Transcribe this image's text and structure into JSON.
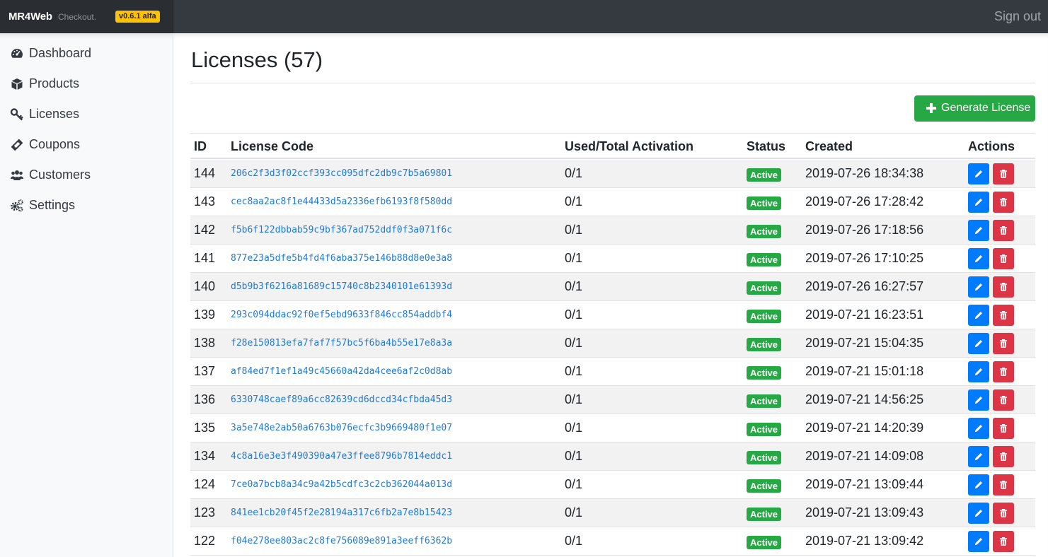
{
  "header": {
    "brand": "MR4Web",
    "brand_sub": "Checkout.",
    "version": "v0.6.1 alfa",
    "signout_label": "Sign out"
  },
  "sidebar": {
    "items": [
      {
        "label": "Dashboard",
        "icon": "tachometer-icon"
      },
      {
        "label": "Products",
        "icon": "box-icon"
      },
      {
        "label": "Licenses",
        "icon": "key-icon"
      },
      {
        "label": "Coupons",
        "icon": "ticket-icon"
      },
      {
        "label": "Customers",
        "icon": "users-icon"
      },
      {
        "label": "Settings",
        "icon": "cogs-icon"
      }
    ]
  },
  "main": {
    "title": "Licenses (57)",
    "generate_button": "Generate License",
    "columns": [
      "ID",
      "License Code",
      "Used/Total Activation",
      "Status",
      "Created",
      "Actions"
    ],
    "rows": [
      {
        "id": "144",
        "code": "206c2f3d3f02ccf393cc095dfc2db9c7b5a69801",
        "activation": "0/1",
        "status": "Active",
        "created": "2019-07-26 18:34:38"
      },
      {
        "id": "143",
        "code": "cec8aa2ac8f1e44433d5a2336efb6193f8f580dd",
        "activation": "0/1",
        "status": "Active",
        "created": "2019-07-26 17:28:42"
      },
      {
        "id": "142",
        "code": "f5b6f122dbbab59c9bf367ad752ddf0f3a071f6c",
        "activation": "0/1",
        "status": "Active",
        "created": "2019-07-26 17:18:56"
      },
      {
        "id": "141",
        "code": "877e23a5dfe5b4fd4f6aba375e146b88d8e0e3a8",
        "activation": "0/1",
        "status": "Active",
        "created": "2019-07-26 17:10:25"
      },
      {
        "id": "140",
        "code": "d5b9b3f6216a81689c15740c8b2340101e61393d",
        "activation": "0/1",
        "status": "Active",
        "created": "2019-07-26 16:27:57"
      },
      {
        "id": "139",
        "code": "293c094ddac92f0ef5ebd9633f846cc854addbf4",
        "activation": "0/1",
        "status": "Active",
        "created": "2019-07-21 16:23:51"
      },
      {
        "id": "138",
        "code": "f28e150813efa7faf7f57bc5f6ba4b55e17e8a3a",
        "activation": "0/1",
        "status": "Active",
        "created": "2019-07-21 15:04:35"
      },
      {
        "id": "137",
        "code": "af84ed7f1ef1a49c45660a42da4cee6af2c0d8ab",
        "activation": "0/1",
        "status": "Active",
        "created": "2019-07-21 15:01:18"
      },
      {
        "id": "136",
        "code": "6330748caef89a6cc82639cd6dccd34cfbda45d3",
        "activation": "0/1",
        "status": "Active",
        "created": "2019-07-21 14:56:25"
      },
      {
        "id": "135",
        "code": "3a5e748e2ab50a6763b076ecfc3b9669480f1e07",
        "activation": "0/1",
        "status": "Active",
        "created": "2019-07-21 14:20:39"
      },
      {
        "id": "134",
        "code": "4c8a16e3e3f490390a47e3ffee8796b7814eddc1",
        "activation": "0/1",
        "status": "Active",
        "created": "2019-07-21 14:09:08"
      },
      {
        "id": "124",
        "code": "7ce0a7bcb8a34c9a42b5cdfc3c2cb362044a013d",
        "activation": "0/1",
        "status": "Active",
        "created": "2019-07-21 13:09:44"
      },
      {
        "id": "123",
        "code": "841ee1cb20f45f2e28194a317c6fb2a7e8b15423",
        "activation": "0/1",
        "status": "Active",
        "created": "2019-07-21 13:09:43"
      },
      {
        "id": "122",
        "code": "f04e278ee803ac2c8fe756089e891a3eeff6362b",
        "activation": "0/1",
        "status": "Active",
        "created": "2019-07-21 13:09:42"
      }
    ]
  },
  "colors": {
    "topbar": "#343a40",
    "success": "#28a745",
    "primary": "#007bff",
    "danger": "#dc3545",
    "link": "#1f7ad8",
    "warning": "#ffc107"
  }
}
